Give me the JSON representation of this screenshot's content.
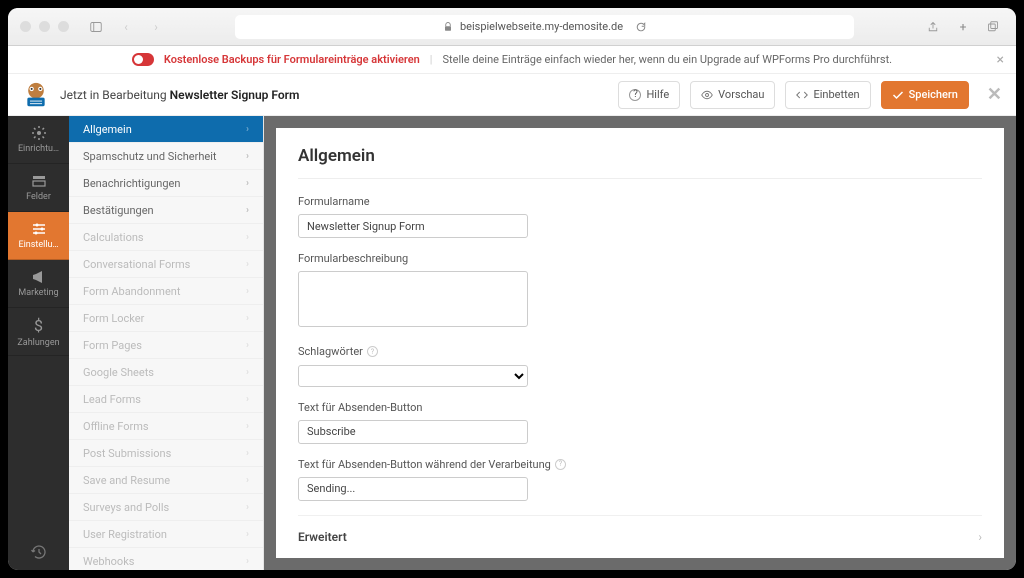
{
  "browser": {
    "url_host": "beispielwebseite.my-demosite.de"
  },
  "promo": {
    "bold": "Kostenlose Backups für Formulareinträge aktivieren",
    "text": "Stelle deine Einträge einfach wieder her, wenn du ein Upgrade auf WPForms Pro durchführst."
  },
  "header": {
    "prefix": "Jetzt in Bearbeitung",
    "form_name": "Newsletter Signup Form",
    "help": "Hilfe",
    "preview": "Vorschau",
    "embed": "Einbetten",
    "save": "Speichern"
  },
  "rail": {
    "setup": "Einrichtu…",
    "fields": "Felder",
    "settings": "Einstellu…",
    "marketing": "Marketing",
    "payments": "Zahlungen"
  },
  "sidebar": {
    "items": [
      {
        "label": "Allgemein",
        "active": true,
        "enabled": true
      },
      {
        "label": "Spamschutz und Sicherheit",
        "active": false,
        "enabled": true
      },
      {
        "label": "Benachrichtigungen",
        "active": false,
        "enabled": true
      },
      {
        "label": "Bestätigungen",
        "active": false,
        "enabled": true
      },
      {
        "label": "Calculations",
        "active": false,
        "enabled": false
      },
      {
        "label": "Conversational Forms",
        "active": false,
        "enabled": false
      },
      {
        "label": "Form Abandonment",
        "active": false,
        "enabled": false
      },
      {
        "label": "Form Locker",
        "active": false,
        "enabled": false
      },
      {
        "label": "Form Pages",
        "active": false,
        "enabled": false
      },
      {
        "label": "Google Sheets",
        "active": false,
        "enabled": false
      },
      {
        "label": "Lead Forms",
        "active": false,
        "enabled": false
      },
      {
        "label": "Offline Forms",
        "active": false,
        "enabled": false
      },
      {
        "label": "Post Submissions",
        "active": false,
        "enabled": false
      },
      {
        "label": "Save and Resume",
        "active": false,
        "enabled": false
      },
      {
        "label": "Surveys and Polls",
        "active": false,
        "enabled": false
      },
      {
        "label": "User Registration",
        "active": false,
        "enabled": false
      },
      {
        "label": "Webhooks",
        "active": false,
        "enabled": false
      }
    ]
  },
  "panel": {
    "title": "Allgemein",
    "form_name_label": "Formularname",
    "form_name_value": "Newsletter Signup Form",
    "form_desc_label": "Formularbeschreibung",
    "form_desc_value": "",
    "tags_label": "Schlagwörter",
    "submit_text_label": "Text für Absenden-Button",
    "submit_text_value": "Subscribe",
    "submit_processing_label": "Text für Absenden-Button während der Verarbeitung",
    "submit_processing_value": "Sending...",
    "advanced": "Erweitert"
  }
}
